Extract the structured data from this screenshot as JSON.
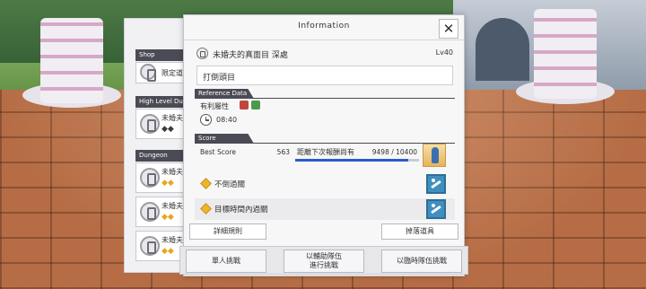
{
  "list_panel": {
    "categories": [
      "Shop",
      "High Level Dungeon",
      "Dungeon"
    ],
    "shop_item": "限定道",
    "cards": [
      {
        "title": "未婚夫",
        "marks": "◆◆"
      },
      {
        "title": "未婚夫",
        "marks": "◆◆"
      },
      {
        "title": "未婚夫",
        "marks": "◆◆"
      },
      {
        "title": "未婚夫",
        "marks": "◆◆"
      }
    ]
  },
  "dialog": {
    "title": "Information",
    "close_label": "✕",
    "quest_name": "未婚夫的真面目 深處",
    "quest_level": "Lv40",
    "description": "打倒頭目",
    "reference_section": "Reference Data",
    "attribute_label": "有利屬性",
    "time_limit": "08:40",
    "score_section": "Score",
    "best_score_label": "Best Score",
    "best_score_value": "563",
    "next_reward_label": "距離下次報酬尚有",
    "progress_text": "9498 / 10400",
    "progress_fraction": 0.913,
    "objectives": [
      "不倒過關",
      "目標時間內過關"
    ],
    "rules_button": "詳細規則",
    "drops_button": "掉落道具"
  },
  "actions": [
    "單人挑戰",
    "以輔助隊伍\n進行挑戰",
    "以臨時隊伍挑戰"
  ],
  "colors": {
    "header_dark": "#4a4b55",
    "progress": "#2a5bd0",
    "gem": "#efb42a",
    "attr_fire": "#c0483a",
    "attr_wind": "#4a9a4a"
  }
}
